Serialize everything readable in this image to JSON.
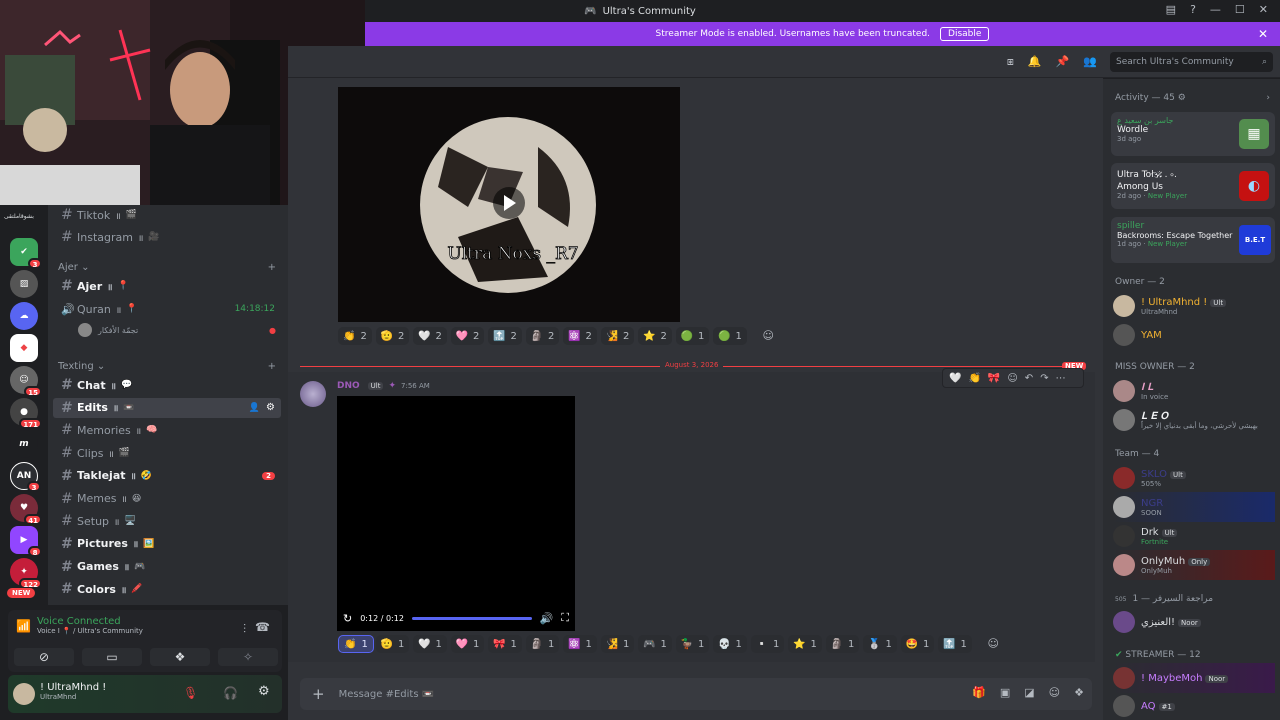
{
  "app": {
    "title": "Ultra's Community"
  },
  "banner": {
    "text": "Streamer Mode is enabled. Usernames have been truncated.",
    "button": "Disable"
  },
  "search": {
    "placeholder": "Search Ultra's Community"
  },
  "servers": {
    "top_label": "بشوقاملتقى",
    "items": [
      {
        "badge": "3",
        "color": "#3ba55c"
      },
      {
        "badge": "",
        "color": "#555"
      },
      {
        "badge": "",
        "color": "#5865f2"
      },
      {
        "badge": "",
        "color": "#ed4245"
      },
      {
        "badge": "15",
        "color": "#666"
      },
      {
        "badge": "171",
        "color": "#444"
      },
      {
        "badge": "",
        "color": "#1e1f22",
        "label": "m"
      },
      {
        "badge": "3",
        "color": "#333",
        "label": "AN"
      },
      {
        "badge": "41",
        "color": "#7a2b3a"
      },
      {
        "badge": "8",
        "color": "#9146ff"
      },
      {
        "badge": "122",
        "color": "#c41e3a"
      }
    ],
    "new_label": "NEW"
  },
  "channels": {
    "items_top": [
      {
        "name": "Tiktok",
        "icon": "🎬",
        "bold": false
      },
      {
        "name": "Instagram",
        "icon": "🎥",
        "bold": false
      }
    ],
    "cat1": "Ajer",
    "ajer": {
      "name": "Ajer",
      "icon": "📍"
    },
    "quran": {
      "name": "Quran",
      "icon": "📍",
      "time": "14:18:12"
    },
    "voice_user": "تجمّة الأفكار",
    "cat2": "Texting",
    "texting": [
      {
        "name": "Chat",
        "icon": "💬",
        "bold": true,
        "badge": ""
      },
      {
        "name": "Edits",
        "icon": "📼",
        "bold": true,
        "selected": true,
        "badge": ""
      },
      {
        "name": "Memories",
        "icon": "🧠",
        "bold": false,
        "badge": ""
      },
      {
        "name": "Clips",
        "icon": "🎬",
        "bold": false,
        "badge": ""
      },
      {
        "name": "Taklejat",
        "icon": "🤣",
        "bold": true,
        "badge": "2"
      },
      {
        "name": "Memes",
        "icon": "😆",
        "bold": false,
        "badge": ""
      },
      {
        "name": "Setup",
        "icon": "🖥️",
        "bold": false,
        "badge": ""
      },
      {
        "name": "Pictures",
        "icon": "🖼️",
        "bold": true,
        "badge": ""
      },
      {
        "name": "Games",
        "icon": "🎮",
        "bold": true,
        "badge": ""
      },
      {
        "name": "Colors",
        "icon": "🖍️",
        "bold": true,
        "badge": ""
      }
    ]
  },
  "voice": {
    "status": "Voice Connected",
    "sub": "Voice I 📍 / Ultra's Community"
  },
  "user": {
    "name": "! UltraMhnd !",
    "status": "UltraMhnd"
  },
  "messages": {
    "video1_caption": "Ultra Noxs _R7",
    "reactions1": [
      {
        "e": "👏",
        "n": "2"
      },
      {
        "e": "🫡",
        "n": "2"
      },
      {
        "e": "🤍",
        "n": "2"
      },
      {
        "e": "🩷",
        "n": "2"
      },
      {
        "e": "🔝",
        "n": "2"
      },
      {
        "e": "🗿",
        "n": "2"
      },
      {
        "e": "⚛️",
        "n": "2"
      },
      {
        "e": "🧏",
        "n": "2"
      },
      {
        "e": "⭐",
        "n": "2"
      },
      {
        "e": "🟢",
        "n": "1"
      },
      {
        "e": "🟢",
        "n": "1"
      }
    ],
    "divider_date": "August 3, 2026",
    "new_label": "NEW",
    "author": "DNO",
    "author_tag": "Ult",
    "time": "7:56 AM",
    "video2_time": "0:12 / 0:12",
    "reactions2": [
      {
        "e": "👏",
        "n": "1",
        "active": true
      },
      {
        "e": "🫡",
        "n": "1"
      },
      {
        "e": "🤍",
        "n": "1"
      },
      {
        "e": "🩷",
        "n": "1"
      },
      {
        "e": "🎀",
        "n": "1"
      },
      {
        "e": "🗿",
        "n": "1"
      },
      {
        "e": "⚛️",
        "n": "1"
      },
      {
        "e": "🧏",
        "n": "1"
      },
      {
        "e": "🎮",
        "n": "1"
      },
      {
        "e": "🦆",
        "n": "1"
      },
      {
        "e": "💀",
        "n": "1"
      },
      {
        "e": "▫️",
        "n": "1"
      },
      {
        "e": "⭐",
        "n": "1"
      },
      {
        "e": "🗿",
        "n": "1"
      },
      {
        "e": "🥈",
        "n": "1"
      },
      {
        "e": "🤩",
        "n": "1"
      },
      {
        "e": "🔝",
        "n": "1"
      }
    ]
  },
  "composer": {
    "placeholder": "Message #Edits 📼"
  },
  "activity": {
    "title": "Activity — 45 ⚙",
    "cards": [
      {
        "user": "جاسر بن سعيد ع",
        "game": "Wordle",
        "meta": "3d ago",
        "extra": ""
      },
      {
        "user": "Ultra Toł🕉 . ৹.",
        "game": "Among Us",
        "meta": "2d ago",
        "extra": "New Player"
      },
      {
        "user": "spiller",
        "game": "Backrooms: Escape Together",
        "meta": "1d ago",
        "extra": "New Player"
      }
    ]
  },
  "members": {
    "owner_title": "Owner — 2",
    "owner": [
      {
        "name": "! UltraMhnd !",
        "tag": "Ult",
        "sub": "UltraMhnd",
        "color": "#f0b132"
      },
      {
        "name": "YAM",
        "tag": "",
        "sub": "",
        "color": "#f0b132"
      }
    ],
    "miss_title": "MISS OWNER — 2",
    "miss": [
      {
        "name": "𝐈 𝐋",
        "sub": "In voice"
      },
      {
        "name": "𝐋 𝐄 𝐎",
        "sub": "بهبشي لأحرشي، وما أبقى بدنياي إلا خيراً"
      }
    ],
    "team_title": "Team — 4",
    "team": [
      {
        "name": "SKLO",
        "tag": "Ult",
        "sub": "505%"
      },
      {
        "name": "NGR",
        "tag": "",
        "sub": "SOON"
      },
      {
        "name": "Drk",
        "tag": "Ult",
        "sub": "Fortnite"
      },
      {
        "name": "OnlyMuh",
        "tag": "Only",
        "sub": "OnlyMuh"
      }
    ],
    "review_title": "مراجعة السيرفر — 1",
    "review_prefix": "505",
    "review": [
      {
        "name": "العنيزي!",
        "tag": "Noor"
      }
    ],
    "streamer_title": "STREAMER — 12",
    "streamer": [
      {
        "name": "! MaybeMoh",
        "tag": "Noor"
      },
      {
        "name": "AQ",
        "tag": "#1"
      }
    ]
  }
}
